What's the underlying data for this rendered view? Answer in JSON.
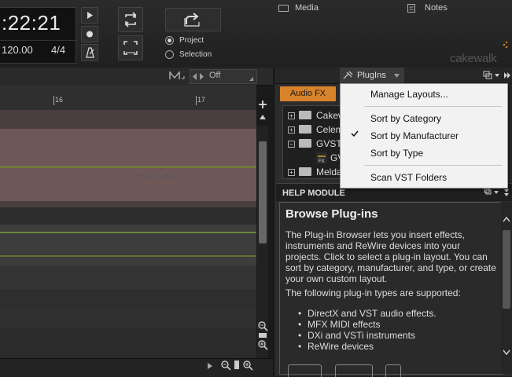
{
  "transport": {
    "time": ":22:21",
    "tempo": "120.00",
    "meter": "4/4",
    "range_options": [
      "Project",
      "Selection"
    ]
  },
  "brand": "cakewalk",
  "track_header": {
    "off_label": "Off"
  },
  "ruler": {
    "ticks": [
      "16",
      "17"
    ]
  },
  "right_tabs": {
    "media": "Media",
    "plugins": "PlugIns",
    "notes": "Notes"
  },
  "plugin_browser": {
    "audio_fx_label": "Audio FX",
    "tree_items": [
      "Cakew",
      "Celem",
      "GVST",
      "GV",
      "Melda"
    ]
  },
  "menu": {
    "items": [
      "Manage Layouts...",
      "Sort by Category",
      "Sort by Manufacturer",
      "Sort by Type",
      "Scan VST Folders"
    ],
    "checked_index": 2
  },
  "help": {
    "panel_title": "HELP MODULE",
    "heading": "Browse Plug-ins",
    "para1": "The Plug-in Browser lets you insert effects, instruments and ReWire devices into your projects. Click to select a plug-in layout. You can sort by category, manufacturer, and type, or create your own custom layout.",
    "para2": "The following plug-in types are supported:",
    "list": [
      "DirectX and VST audio effects.",
      "MFX MIDI effects",
      "DXi and VSTi instruments",
      "ReWire devices"
    ]
  },
  "colors": {
    "accent": "#d8822c",
    "track_clip": "#6e5757",
    "automation_line": "#9acd32"
  }
}
